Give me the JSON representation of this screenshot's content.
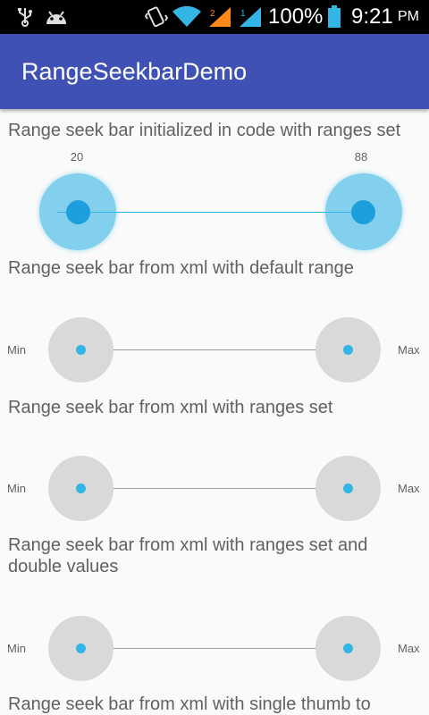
{
  "status_bar": {
    "battery_percent": "100%",
    "time": "9:21",
    "ampm": "PM",
    "icons": [
      "usb-icon",
      "android-icon",
      "vibrate-icon",
      "wifi-icon",
      "signal-icon",
      "signal-icon",
      "battery-icon"
    ]
  },
  "app_bar": {
    "title": "RangeSeekbarDemo"
  },
  "sections": [
    {
      "title": "Range seek bar initialized in code with ranges set",
      "min_value": "20",
      "max_value": "88"
    },
    {
      "title": "Range seek bar from xml with default range",
      "min_label": "Min",
      "max_label": "Max"
    },
    {
      "title": "Range seek bar from xml with ranges set",
      "min_label": "Min",
      "max_label": "Max"
    },
    {
      "title_line1": "Range seek bar from xml with ranges set and",
      "title_line2": "double values",
      "min_label": "Min",
      "max_label": "Max"
    },
    {
      "title": "Range seek bar from xml with single thumb to"
    }
  ],
  "colors": {
    "accent": "#33b5e5",
    "primary": "#3f51b5"
  }
}
